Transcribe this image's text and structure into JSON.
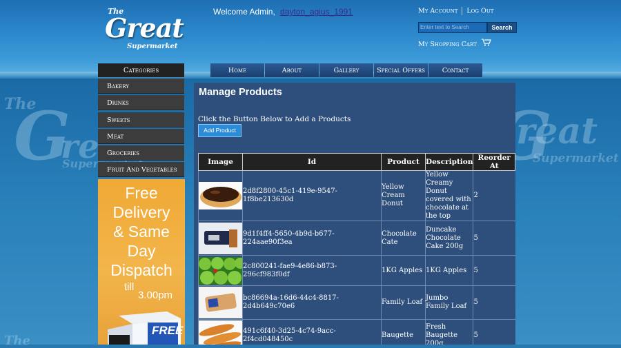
{
  "header": {
    "logo": {
      "the": "The",
      "great": "Great",
      "supermarket": "Supermarket"
    },
    "welcome_text": "Welcome Admin,",
    "username": "dayton_agius_1991",
    "my_account": "My Account",
    "log_out": "Log Out",
    "search_placeholder": "Enter text to Search",
    "search_button": "Search",
    "cart_label": "My Shopping Cart"
  },
  "sidebar": {
    "header": "Categories",
    "items": [
      "Bakery",
      "Drinks",
      "Sweets",
      "Meat",
      "Groceries",
      "Fruit And Vegetables"
    ]
  },
  "promo": {
    "line1": "Free",
    "line2": "Delivery",
    "line3": "& Same",
    "line4": "Day",
    "line5": "Dispatch",
    "till": "till",
    "time": "3.00pm",
    "box_text": "FREE"
  },
  "nav": [
    "Home",
    "About",
    "Gallery",
    "Special Offers",
    "Contact"
  ],
  "main": {
    "title": "Manage Products",
    "instruction": "Click the Button Below to Add a Products",
    "add_button": "Add Product",
    "columns": [
      "Image",
      "Id",
      "Product",
      "Description",
      "Reorder At"
    ],
    "rows": [
      {
        "image": "donut",
        "id": "2d8f2800-45c1-419e-9547-1f8be213630d",
        "product": "Yellow Cream Donut",
        "description": "Yellow Creamy Donut covered with chocolate at the top",
        "reorder": "2"
      },
      {
        "image": "cake",
        "id": "9d1f4ff4-5650-4b9d-b677-224aae90f3ea",
        "product": "Chocolate Cate",
        "description": "Duncake Chocolate Cake 200g",
        "reorder": "5"
      },
      {
        "image": "apples",
        "id": "2c800241-fae9-4e86-b873-296cf983f0df",
        "product": "1KG Apples",
        "description": "1KG Apples",
        "reorder": "5"
      },
      {
        "image": "loaf",
        "id": "bc86694a-16d6-44c4-8817-2d4b649c70e6",
        "product": "Family Loaf",
        "description": "Jumbo Family Loaf",
        "reorder": "5"
      },
      {
        "image": "baguette",
        "id": "491c6f40-3d25-4c74-9acc-2f4cd048450c",
        "product": "Baugette",
        "description": "Fresh Baugette 200g",
        "reorder": "5"
      }
    ]
  },
  "colors": {
    "panel_bg": "#2e4f7c",
    "nav_bg": "#1b3f70",
    "sidebar_bg": "#3c3c3c",
    "promo_bg": "#f0a935",
    "link_user": "#3a2a8a"
  }
}
